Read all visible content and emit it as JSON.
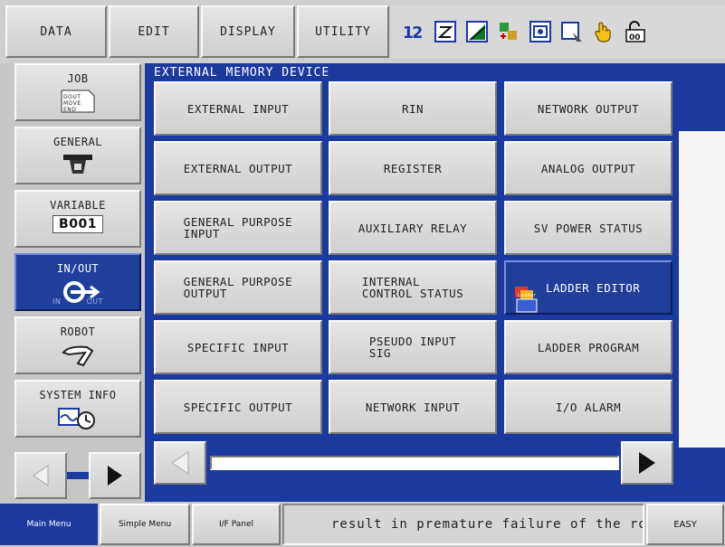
{
  "top_menu": [
    {
      "label": "DATA"
    },
    {
      "label": "EDIT"
    },
    {
      "label": "DISPLAY"
    },
    {
      "label": "UTILITY"
    }
  ],
  "status_icons": [
    "sequence-number-icon",
    "edit-mode-icon",
    "signal-level-icon",
    "coordinate-icon",
    "teach-mode-icon",
    "screen-icon",
    "hand-icon",
    "security-icon"
  ],
  "left_nav": [
    {
      "label": "JOB",
      "icon": "job-document-icon",
      "icon_text": [
        "DOUT",
        "MOVE",
        "END"
      ]
    },
    {
      "label": "GENERAL",
      "icon": "general-tool-icon"
    },
    {
      "label": "VARIABLE",
      "icon": "variable-icon",
      "icon_text": "B001"
    },
    {
      "label": "IN/OUT",
      "icon": "in-out-icon",
      "icon_text": [
        "IN",
        "OUT"
      ],
      "active": true
    },
    {
      "label": "ROBOT",
      "icon": "robot-arm-icon"
    },
    {
      "label": "SYSTEM INFO",
      "icon": "system-info-icon"
    }
  ],
  "main": {
    "title": "EXTERNAL MEMORY DEVICE",
    "buttons": [
      [
        "EXTERNAL INPUT",
        "RIN",
        "NETWORK OUTPUT"
      ],
      [
        "EXTERNAL OUTPUT",
        "REGISTER",
        "ANALOG OUTPUT"
      ],
      [
        "GENERAL PURPOSE\nINPUT",
        "AUXILIARY RELAY",
        "SV POWER STATUS"
      ],
      [
        "GENERAL PURPOSE\nOUTPUT",
        "INTERNAL\n   CONTROL STATUS",
        "LADDER EDITOR"
      ],
      [
        "SPECIFIC INPUT",
        "PSEUDO INPUT\nSIG",
        "LADDER PROGRAM"
      ],
      [
        "SPECIFIC OUTPUT",
        "NETWORK INPUT",
        "I/O ALARM"
      ]
    ],
    "selected_icon_text": "Ladder"
  },
  "bottom": {
    "main_menu": "Main Menu",
    "simple_menu": "Simple Menu",
    "if_panel": "I/F Panel",
    "message": "result in premature failure of the rob",
    "mode": "EASY"
  },
  "colors": {
    "panel_blue": "#1b3aa0",
    "selected_blue": "#1f3f9b",
    "button_gray": "#d8d8d8"
  }
}
